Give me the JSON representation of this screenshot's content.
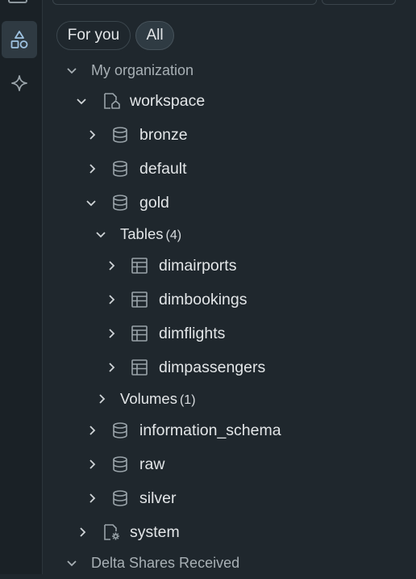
{
  "filters": {
    "for_you": "For you",
    "all": "All"
  },
  "tree": {
    "org_label": "My organization",
    "workspace": "workspace",
    "schemas": {
      "bronze": "bronze",
      "default": "default",
      "gold": "gold",
      "information_schema": "information_schema",
      "raw": "raw",
      "silver": "silver"
    },
    "gold_tables_label": "Tables",
    "gold_tables_count": "(4)",
    "tables": [
      "dimairports",
      "dimbookings",
      "dimflights",
      "dimpassengers"
    ],
    "volumes_label": "Volumes",
    "volumes_count": "(1)",
    "system": "system",
    "delta_shares_label": "Delta Shares Received"
  },
  "colors": {
    "background": "#1f272d",
    "rail": "#1a2126",
    "icon": "#9aa4aa",
    "text": "#e3e6e8",
    "section_text": "#a8b0b5"
  }
}
